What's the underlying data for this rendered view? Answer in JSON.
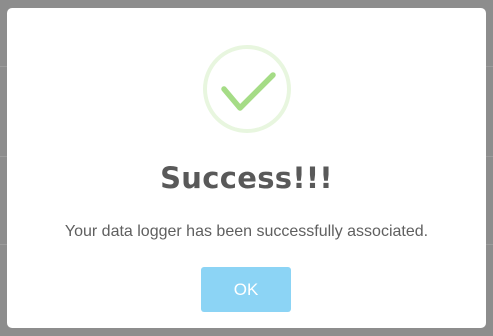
{
  "dialog": {
    "icon": "checkmark-icon",
    "title": "Success!!!",
    "message": "Your data logger has been successfully associated.",
    "ok_label": "OK"
  },
  "colors": {
    "overlay": "#8d8d8d",
    "dialog_bg": "#ffffff",
    "checkmark": "#a5dc86",
    "ring": "#e8f6df",
    "title_text": "#595959",
    "message_text": "#5f5f5f",
    "button_bg": "#8cd4f5",
    "button_text": "#ffffff"
  }
}
